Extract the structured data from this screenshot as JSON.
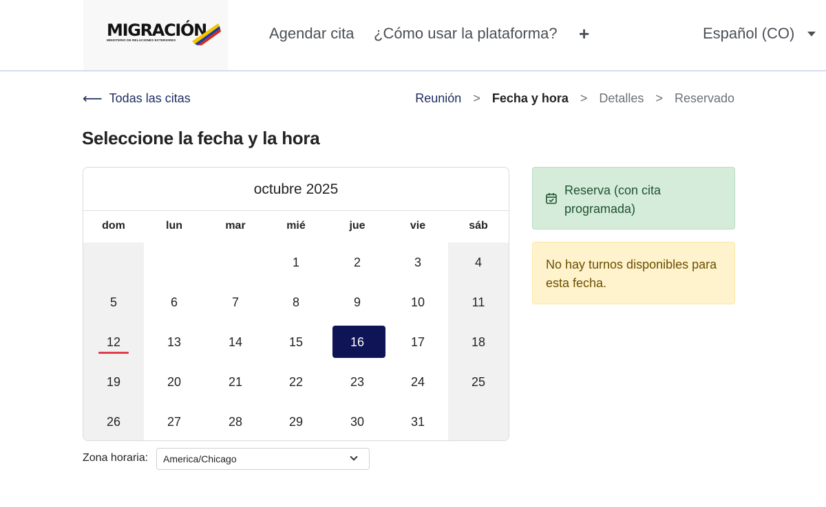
{
  "header": {
    "logo": {
      "title": "MIGRACIÓN",
      "subtitle": "MINISTERIO DE RELACIONES EXTERIORES"
    },
    "nav": [
      {
        "label": "Agendar cita"
      },
      {
        "label": "¿Cómo usar la plataforma?"
      }
    ],
    "plus_icon": "plus-icon",
    "language": "Español (CO)"
  },
  "back_link": {
    "label": "Todas las citas",
    "icon": "arrow-left-icon"
  },
  "breadcrumb": {
    "steps": [
      "Reunión",
      "Fecha y hora",
      "Detalles",
      "Reservado"
    ],
    "active": "Fecha y hora",
    "separator": ">"
  },
  "page_title": "Seleccione la fecha y la hora",
  "calendar": {
    "month": "octubre 2025",
    "weekdays": [
      "dom",
      "lun",
      "mar",
      "mié",
      "jue",
      "vie",
      "sáb"
    ],
    "weeks": [
      [
        "",
        "",
        "",
        "1",
        "2",
        "3",
        "4"
      ],
      [
        "5",
        "6",
        "7",
        "8",
        "9",
        "10",
        "11"
      ],
      [
        "12",
        "13",
        "14",
        "15",
        "16",
        "17",
        "18"
      ],
      [
        "19",
        "20",
        "21",
        "22",
        "23",
        "24",
        "25"
      ],
      [
        "26",
        "27",
        "28",
        "29",
        "30",
        "31",
        ""
      ]
    ],
    "selected_day": "16",
    "today": "12",
    "selected_color": "#0f1457",
    "today_underline_color": "#e23b4a"
  },
  "timezone": {
    "label": "Zona horaria:",
    "value": "America/Chicago"
  },
  "status_boxes": {
    "reservation": {
      "text": "Reserva (con cita programada)",
      "icon": "calendar-check-icon",
      "color": "#d4ecd9"
    },
    "availability": {
      "text": "No hay turnos disponibles para esta fecha.",
      "color": "#fff3cd"
    }
  }
}
